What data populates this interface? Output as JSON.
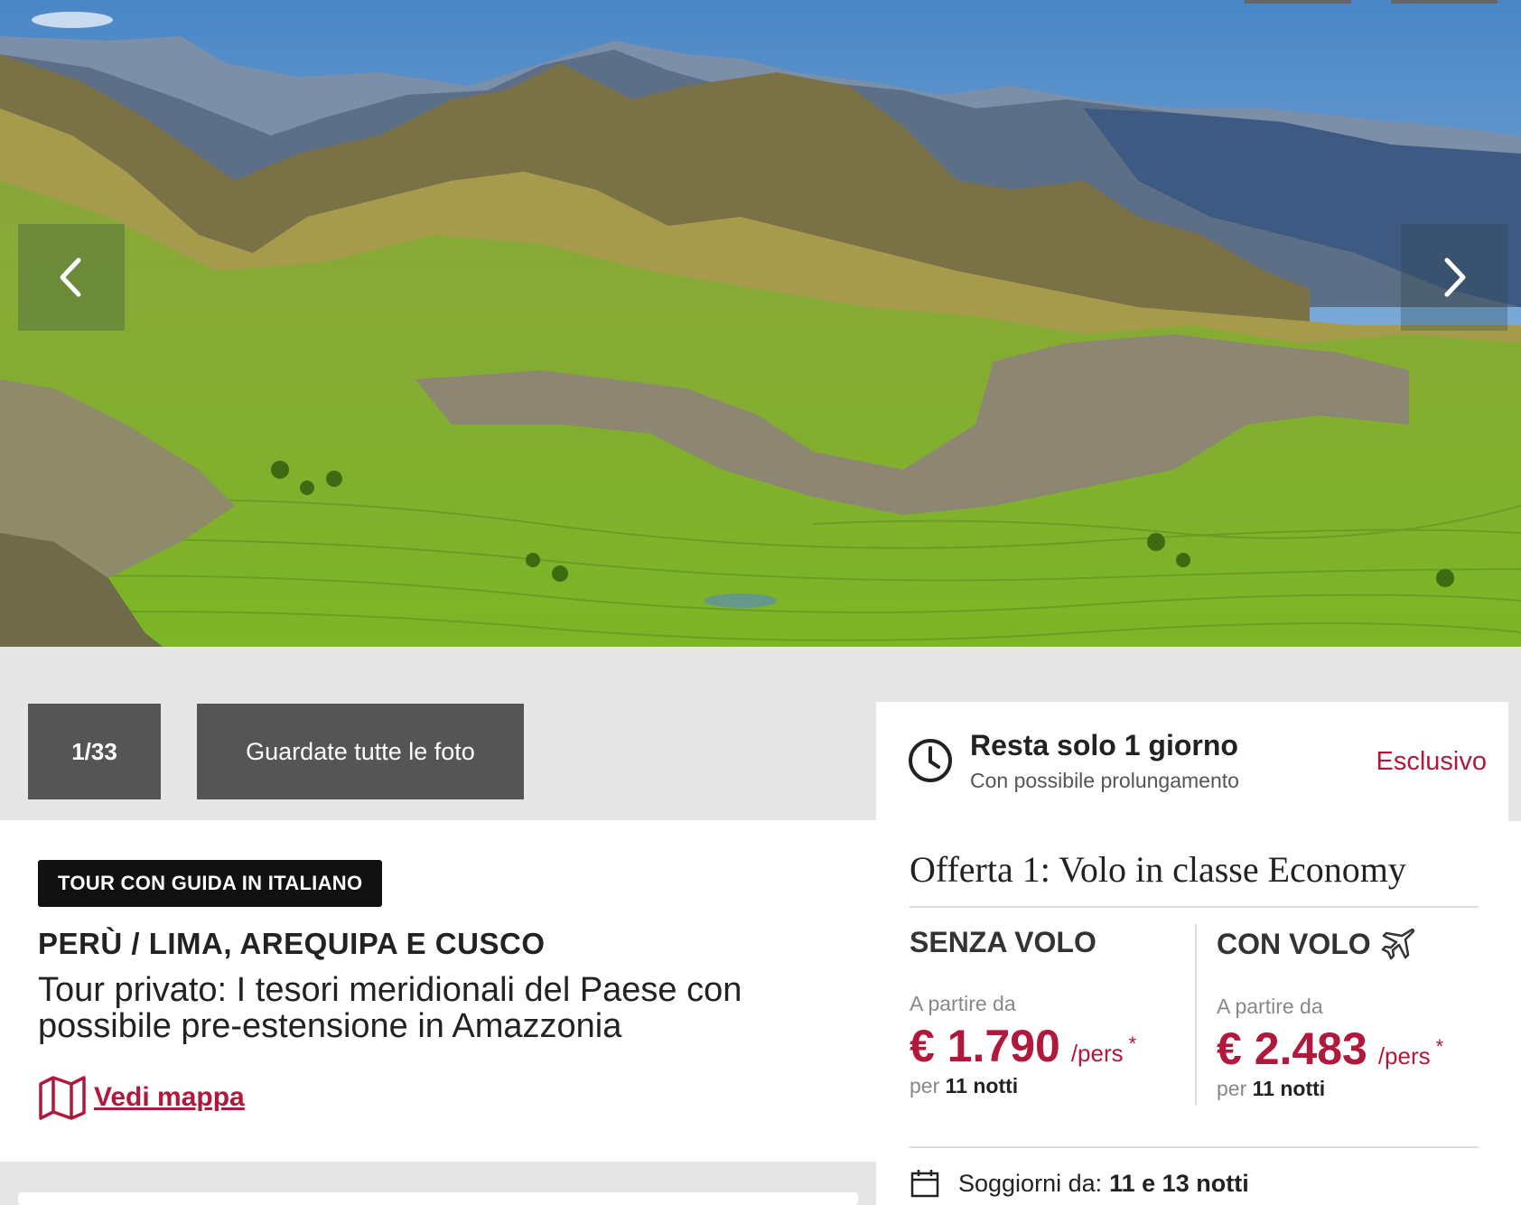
{
  "gallery": {
    "counter": "1/33",
    "all_photos_label": "Guardate tutte le foto",
    "prev_icon": "chevron-left-icon",
    "next_icon": "chevron-right-icon"
  },
  "tour": {
    "badge": "TOUR CON GUIDA IN ITALIANO",
    "destination": "PERÙ / LIMA, AREQUIPA E CUSCO",
    "description": "Tour privato: I tesori meridionali del Paese con possibile pre-estensione in Amazzonia",
    "map_link": "Vedi mappa",
    "map_icon": "map-icon"
  },
  "deadline": {
    "title": "Resta solo 1 giorno",
    "subtitle": "Con possibile prolungamento",
    "exclusive": "Esclusivo",
    "icon": "clock-icon"
  },
  "offer": {
    "title": "Offerta 1: Volo in classe Economy",
    "without_flight": {
      "title": "SENZA VOLO",
      "from_label": "A partire da",
      "price": "€ 1.790",
      "per": "/pers",
      "asterisk": "*",
      "nights_prefix": "per",
      "nights": "11 notti"
    },
    "with_flight": {
      "title": "CON VOLO",
      "icon": "airplane-icon",
      "from_label": "A partire da",
      "price": "€ 2.483",
      "per": "/pers",
      "asterisk": "*",
      "nights_prefix": "per",
      "nights": "11 notti"
    },
    "stay_label": "Soggiorni da:",
    "stay_value": "11 e 13 notti",
    "stay_icon": "calendar-icon"
  },
  "colors": {
    "accent": "#b0183c",
    "button_bg": "#555555",
    "page_bg": "#e6e6e6"
  }
}
